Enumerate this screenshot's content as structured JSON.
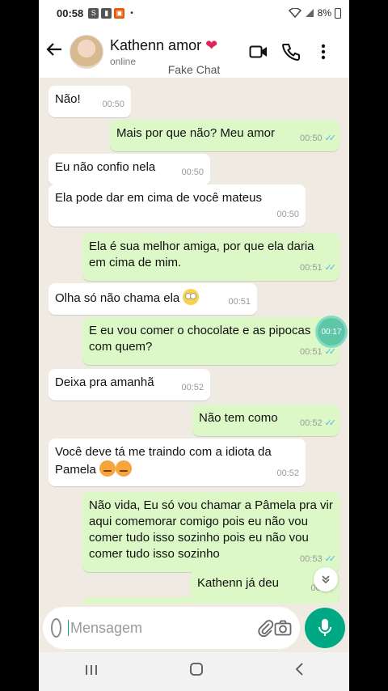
{
  "statusbar": {
    "time": "00:58",
    "icons": [
      "s-icon",
      "lock-icon",
      "gift-icon"
    ],
    "dot": "•",
    "battery": "8%"
  },
  "header": {
    "name": "Kathenn amor",
    "heart": "❤",
    "status": "online",
    "app_label": "Fake Chat"
  },
  "messages": [
    {
      "dir": "in",
      "text": "Não!",
      "time": "00:50"
    },
    {
      "dir": "out",
      "text": "Mais por que não? Meu amor",
      "time": "00:50"
    },
    {
      "dir": "in",
      "text": "Eu não confio nela",
      "time": "00:50"
    },
    {
      "dir": "in",
      "text": "Ela pode dar em cima de você mateus",
      "time": "00:50"
    },
    {
      "dir": "out",
      "text": "Ela é sua melhor amiga, por que ela daria em cima de mim.",
      "time": "00:51"
    },
    {
      "dir": "in",
      "text": "Olha só não chama ela",
      "emoji": "face-with-rolling-eyes",
      "time": "00:51"
    },
    {
      "dir": "out",
      "text": "E eu vou comer o chocolate e as pipocas com quem?",
      "time": "00:51"
    },
    {
      "dir": "in",
      "text": "Deixa pra amanhã",
      "time": "00:52"
    },
    {
      "dir": "out",
      "text": "Não tem como",
      "time": "00:52"
    },
    {
      "dir": "in",
      "text": "Você deve tá me traindo com a idiota da Pamela",
      "emoji": "angry-face x2",
      "time": "00:52"
    },
    {
      "dir": "out",
      "text": "Não vida,  Eu só vou chamar a Pâmela pra vir aqui comemorar comigo pois eu não vou comer tudo isso sozinho pois eu não vou comer tudo isso sozinho",
      "time": "00:53"
    },
    {
      "dir": "out",
      "text": "Kathenn já deu",
      "time": "00:54"
    }
  ],
  "overlay_timer": "00:17",
  "composer": {
    "placeholder": "Mensagem"
  },
  "colors": {
    "accent": "#00a884",
    "outgoing_bubble": "#dcf8c6",
    "incoming_bubble": "#ffffff",
    "chat_bg": "#efeae2",
    "read_ticks": "#4fb6ec"
  }
}
